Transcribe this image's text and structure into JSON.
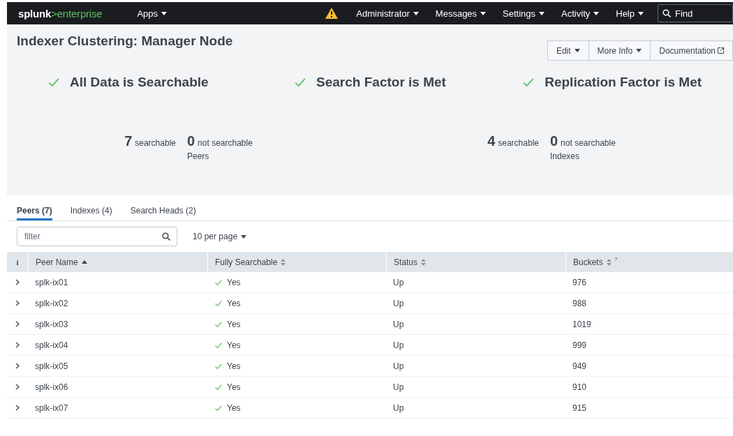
{
  "topbar": {
    "logo_brand": "splunk",
    "logo_product": ">enterprise",
    "apps_menu": "Apps",
    "warning": true,
    "menus": [
      "Administrator",
      "Messages",
      "Settings",
      "Activity",
      "Help"
    ],
    "search": {
      "placeholder": "Find"
    }
  },
  "page": {
    "title": "Indexer Clustering: Manager Node",
    "actions": [
      {
        "label": "Edit",
        "kind": "dropdown"
      },
      {
        "label": "More Info",
        "kind": "dropdown"
      },
      {
        "label": "Documentation",
        "kind": "external"
      }
    ]
  },
  "statuses": [
    {
      "label": "All Data is Searchable",
      "ok": true
    },
    {
      "label": "Search Factor is Met",
      "ok": true
    },
    {
      "label": "Replication Factor is Met",
      "ok": true
    }
  ],
  "counts": [
    {
      "searchable": "7",
      "searchable_label": "searchable",
      "not_searchable": "0",
      "not_searchable_label": "not searchable",
      "caption": "Peers"
    },
    {
      "searchable": "4",
      "searchable_label": "searchable",
      "not_searchable": "0",
      "not_searchable_label": "not searchable",
      "caption": "Indexes"
    }
  ],
  "tabs": [
    {
      "label": "Peers (7)",
      "selected": true
    },
    {
      "label": "Indexes (4)",
      "selected": false
    },
    {
      "label": "Search Heads (2)",
      "selected": false
    }
  ],
  "filter": {
    "placeholder": "filter"
  },
  "page_size": "10 per page",
  "table": {
    "info_column": "i",
    "columns": [
      {
        "label": "Peer Name",
        "sorted": true
      },
      {
        "label": "Fully Searchable",
        "sorted": false
      },
      {
        "label": "Status",
        "sorted": false
      },
      {
        "label": "Buckets",
        "sorted": false,
        "help": "?"
      }
    ],
    "rows": [
      {
        "name": "splk-ix01",
        "searchable": "Yes",
        "fully_searchable": true,
        "status": "Up",
        "buckets": "976"
      },
      {
        "name": "splk-ix02",
        "searchable": "Yes",
        "fully_searchable": true,
        "status": "Up",
        "buckets": "988"
      },
      {
        "name": "splk-ix03",
        "searchable": "Yes",
        "fully_searchable": true,
        "status": "Up",
        "buckets": "1019"
      },
      {
        "name": "splk-ix04",
        "searchable": "Yes",
        "fully_searchable": true,
        "status": "Up",
        "buckets": "999"
      },
      {
        "name": "splk-ix05",
        "searchable": "Yes",
        "fully_searchable": true,
        "status": "Up",
        "buckets": "949"
      },
      {
        "name": "splk-ix06",
        "searchable": "Yes",
        "fully_searchable": true,
        "status": "Up",
        "buckets": "910"
      },
      {
        "name": "splk-ix07",
        "searchable": "Yes",
        "fully_searchable": true,
        "status": "Up",
        "buckets": "915"
      }
    ]
  }
}
